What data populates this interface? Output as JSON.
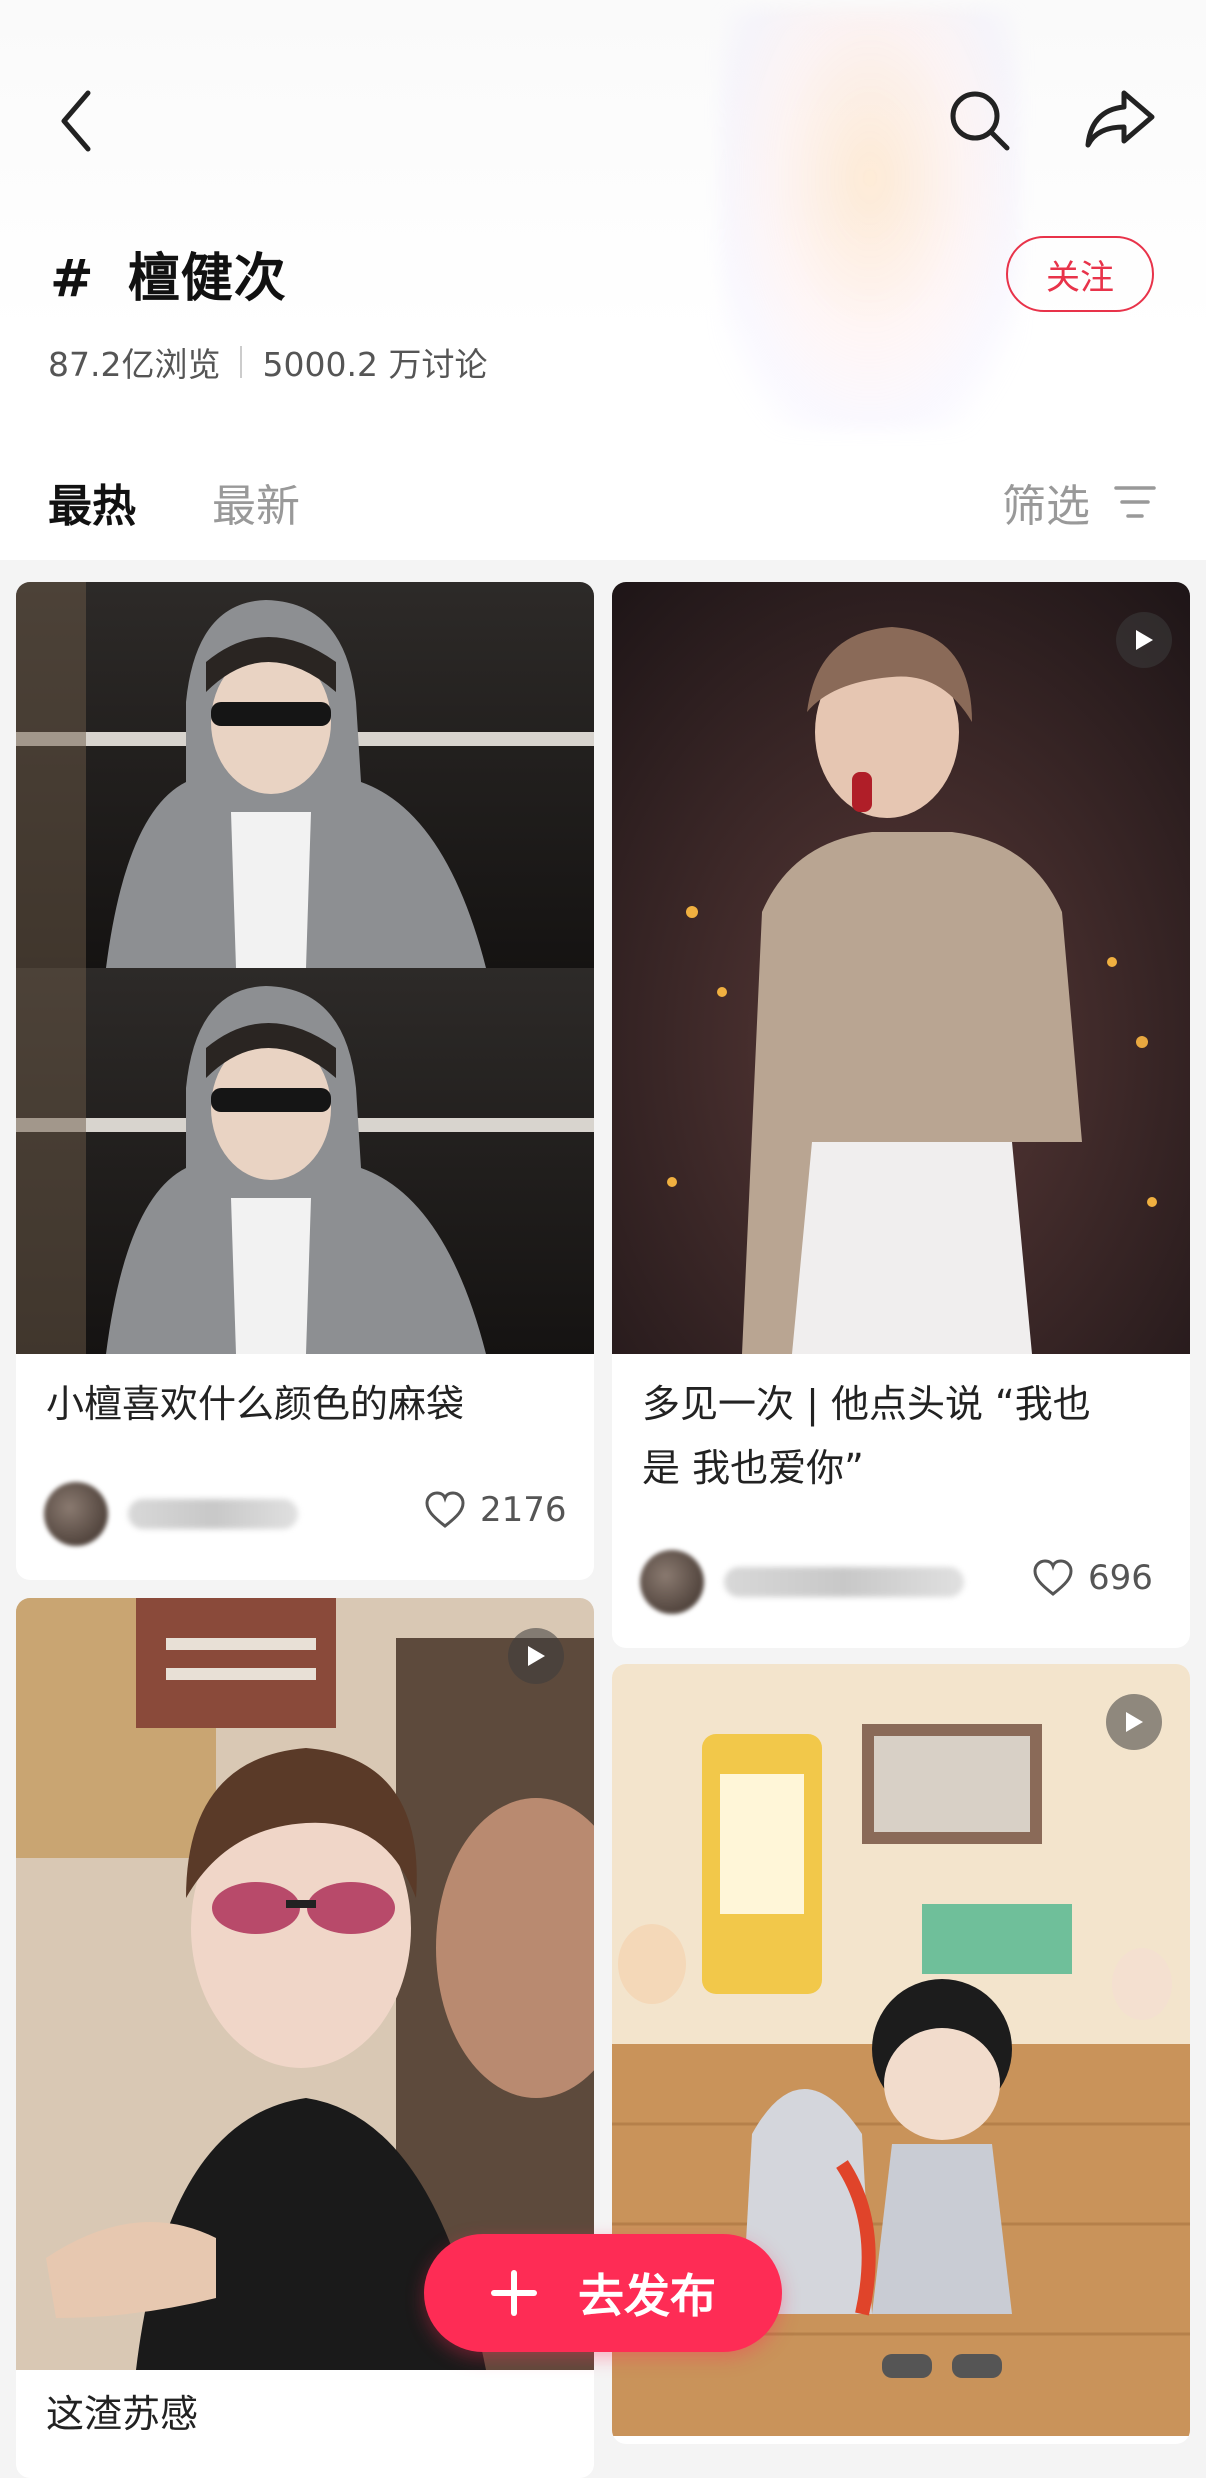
{
  "topic": {
    "hash": "#",
    "name": "檀健次",
    "follow_label": "关注",
    "views": "87.2亿浏览",
    "discussions": "5000.2 万讨论"
  },
  "tabs": {
    "hot": "最热",
    "latest": "最新",
    "filter": "筛选"
  },
  "posts": [
    {
      "caption": "小檀喜欢什么颜色的麻袋",
      "likes": "2176",
      "is_video": false
    },
    {
      "caption_line1": "多见一次 | 他点头说 “我也",
      "caption_line2": "是 我也爱你”",
      "likes": "696",
      "is_video": true
    },
    {
      "caption": "这渣苏感",
      "is_video": true
    },
    {
      "is_video": true
    }
  ],
  "publish_label": "去发布",
  "colors": {
    "accent": "#fe2c55",
    "follow": "#e8334a"
  },
  "icons": [
    "back-icon",
    "search-icon",
    "share-icon",
    "filter-icon",
    "play-icon",
    "heart-icon",
    "plus-icon"
  ]
}
